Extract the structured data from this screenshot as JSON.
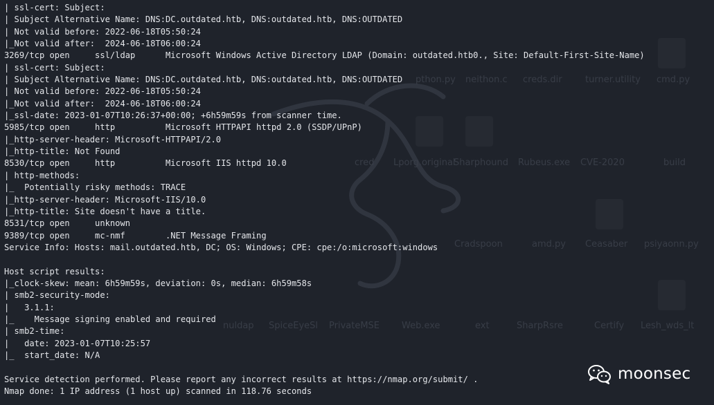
{
  "terminal": {
    "lines": [
      "| ssl-cert: Subject:",
      "| Subject Alternative Name: DNS:DC.outdated.htb, DNS:outdated.htb, DNS:OUTDATED",
      "| Not valid before: 2022-06-18T05:50:24",
      "|_Not valid after:  2024-06-18T06:00:24",
      "3269/tcp open     ssl/ldap      Microsoft Windows Active Directory LDAP (Domain: outdated.htb0., Site: Default-First-Site-Name)",
      "| ssl-cert: Subject:",
      "| Subject Alternative Name: DNS:DC.outdated.htb, DNS:outdated.htb, DNS:OUTDATED",
      "| Not valid before: 2022-06-18T05:50:24",
      "|_Not valid after:  2024-06-18T06:00:24",
      "|_ssl-date: 2023-01-07T10:26:37+00:00; +6h59m59s from scanner time.",
      "5985/tcp open     http          Microsoft HTTPAPI httpd 2.0 (SSDP/UPnP)",
      "|_http-server-header: Microsoft-HTTPAPI/2.0",
      "|_http-title: Not Found",
      "8530/tcp open     http          Microsoft IIS httpd 10.0",
      "| http-methods:",
      "|_  Potentially risky methods: TRACE",
      "|_http-server-header: Microsoft-IIS/10.0",
      "|_http-title: Site doesn't have a title.",
      "8531/tcp open     unknown",
      "9389/tcp open     mc-nmf        .NET Message Framing",
      "Service Info: Hosts: mail.outdated.htb, DC; OS: Windows; CPE: cpe:/o:microsoft:windows",
      "",
      "Host script results:",
      "|_clock-skew: mean: 6h59m59s, deviation: 0s, median: 6h59m58s",
      "| smb2-security-mode:",
      "|   3.1.1:",
      "|_    Message signing enabled and required",
      "| smb2-time:",
      "|   date: 2023-01-07T10:25:57",
      "|_  start_date: N/A",
      "",
      "Service detection performed. Please report any incorrect results at https://nmap.org/submit/ .",
      "Nmap done: 1 IP address (1 host up) scanned in 118.76 seconds"
    ]
  },
  "desktop": {
    "labels": [
      "pthon.py",
      "neithon.c",
      "creds.dir",
      "turner.utility",
      "cmd.py",
      "cred",
      "Lporg.original",
      "Sharphound",
      "Rubeus.exe",
      "CVE-2020",
      "build",
      "Cradspoon",
      "amd.py",
      "Ceasaber",
      "psiyaonn.py",
      "nuldap",
      "SpiceEyeSl",
      "PrivateMSE",
      "Web.exe",
      "ext",
      "SharpRsre",
      "Certify",
      "Lesh_wds_lt"
    ]
  },
  "watermark": {
    "text": "moonsec",
    "icon": "wechat-icon"
  }
}
